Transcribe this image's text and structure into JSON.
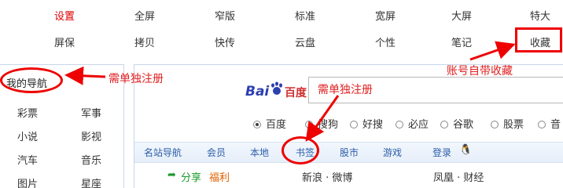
{
  "menu": {
    "row1": [
      "设置",
      "全屏",
      "窄版",
      "标准",
      "宽屏",
      "大屏",
      "特大"
    ],
    "row2": [
      "屏保",
      "拷贝",
      "快传",
      "云盘",
      "个性",
      "笔记",
      "收藏"
    ]
  },
  "left_nav": {
    "title": "我的导航",
    "links": [
      [
        "彩票",
        "军事"
      ],
      [
        "小说",
        "影视"
      ],
      [
        "汽车",
        "音乐"
      ],
      [
        "图片",
        "星座"
      ]
    ]
  },
  "search": {
    "logo_text": "Bai",
    "logo_suffix": "百度",
    "engines": [
      "百度",
      "搜狗",
      "好搜",
      "必应",
      "谷歌",
      "股票",
      "音"
    ],
    "selected": "百度"
  },
  "tabs": [
    "名站导航",
    "会员",
    "本地",
    "书签",
    "股市",
    "游戏",
    "登录"
  ],
  "sites": {
    "share": "分享",
    "fuli": "福利",
    "sina": "新浪 · 微博",
    "ifeng": "凤凰 · 财经"
  },
  "annotations": {
    "register_left": "需单独注册",
    "register_tab": "需单独注册",
    "account_fav": "账号自带收藏"
  },
  "colors": {
    "annotation": "#e00000",
    "link_blue": "#2b5da8",
    "accent_red": "#d00000"
  }
}
